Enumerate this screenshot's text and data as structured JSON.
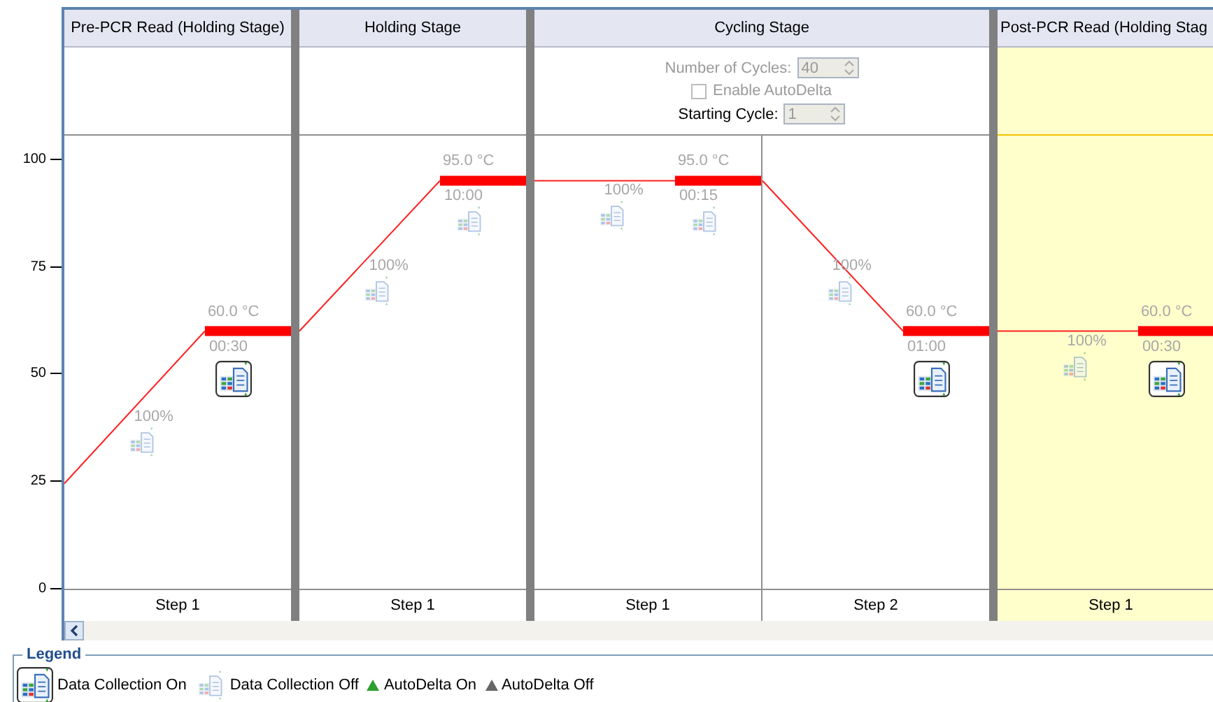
{
  "y_ticks": [
    "100",
    "75",
    "50",
    "25",
    "0"
  ],
  "stages": [
    {
      "title": "Pre-PCR Read (Holding Stage)",
      "selected": false,
      "steps": [
        {
          "label": "Step 1",
          "temperature": "60.0 °C",
          "time": "00:30",
          "ramp_rate": "100%",
          "data_collection": true,
          "ramp_data_collection": false
        }
      ]
    },
    {
      "title": "Holding Stage",
      "selected": false,
      "steps": [
        {
          "label": "Step 1",
          "temperature": "95.0 °C",
          "time": "10:00",
          "ramp_rate": "100%",
          "data_collection": false,
          "ramp_data_collection": false
        }
      ]
    },
    {
      "title": "Cycling Stage",
      "selected": false,
      "settings": [
        {
          "kind": "spinner",
          "label": "Number of Cycles:",
          "value": "40",
          "disabled": true,
          "dimmed": true
        },
        {
          "kind": "checkbox",
          "label": "Enable AutoDelta",
          "checked": false,
          "disabled": true,
          "dimmed": true
        },
        {
          "kind": "spinner",
          "label": "Starting Cycle:",
          "value": "1",
          "disabled": true,
          "dimmed": false
        }
      ],
      "steps": [
        {
          "label": "Step 1",
          "temperature": "95.0 °C",
          "time": "00:15",
          "ramp_rate": "100%",
          "data_collection": false,
          "ramp_data_collection": false
        },
        {
          "label": "Step 2",
          "temperature": "60.0 °C",
          "time": "01:00",
          "ramp_rate": "100%",
          "data_collection": true,
          "ramp_data_collection": false
        }
      ]
    },
    {
      "title": "Post-PCR Read (Holding Stag",
      "selected": true,
      "steps": [
        {
          "label": "Step 1",
          "temperature": "60.0 °C",
          "time": "00:30",
          "ramp_rate": "100%",
          "data_collection": true,
          "ramp_data_collection": false
        }
      ]
    }
  ],
  "legend": {
    "title": "Legend",
    "items": [
      {
        "kind": "data_collection",
        "on": true,
        "label": "Data Collection On"
      },
      {
        "kind": "data_collection",
        "on": false,
        "label": "Data Collection Off"
      },
      {
        "kind": "autodelta",
        "color": "#2e9e2e",
        "label": "AutoDelta On"
      },
      {
        "kind": "autodelta",
        "color": "#666666",
        "label": "AutoDelta Off"
      }
    ]
  }
}
